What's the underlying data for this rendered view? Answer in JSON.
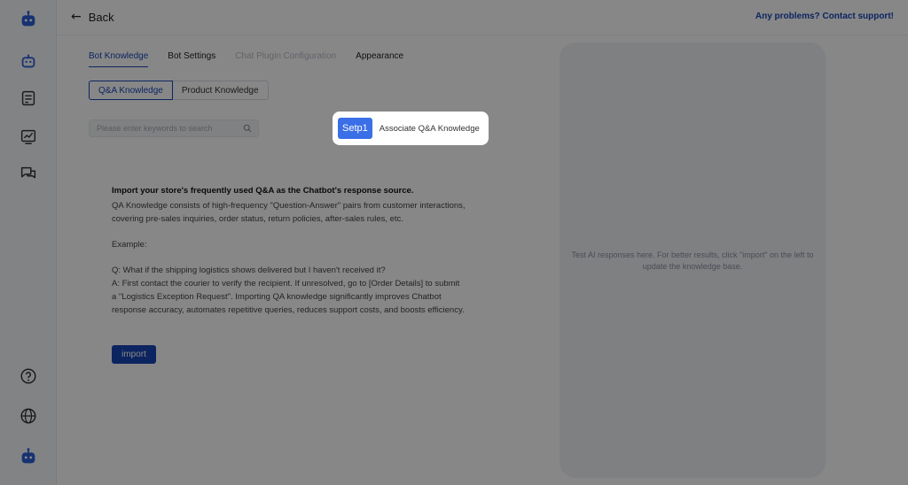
{
  "header": {
    "back_label": "Back",
    "support_link": "Any problems? Contact support!"
  },
  "sidebar": {
    "items": [
      {
        "icon": "bot-logo-icon"
      },
      {
        "icon": "robot-icon"
      },
      {
        "icon": "document-list-icon"
      },
      {
        "icon": "analytics-chart-icon"
      },
      {
        "icon": "chat-bubbles-icon"
      },
      {
        "icon": "help-circle-icon"
      },
      {
        "icon": "globe-icon"
      },
      {
        "icon": "bot-avatar-icon"
      }
    ]
  },
  "tabs": [
    {
      "label": "Bot Knowledge",
      "state": "active"
    },
    {
      "label": "Bot Settings",
      "state": "normal"
    },
    {
      "label": "Chat Plugin Configuration",
      "state": "disabled"
    },
    {
      "label": "Appearance",
      "state": "normal"
    }
  ],
  "knowledge_type": {
    "options": [
      "Q&A Knowledge",
      "Product Knowledge"
    ],
    "selected": "Q&A Knowledge"
  },
  "search": {
    "placeholder": "Please enter keywords to search",
    "value": ""
  },
  "content": {
    "title": "Import your store's frequently used Q&A as the Chatbot's response source.",
    "description": "QA Knowledge consists of high-frequency \"Question-Answer\" pairs from customer interactions, covering pre-sales inquiries, order status, return policies, after-sales rules, etc.",
    "example_label": "Example:",
    "example_q": "Q: What if the shipping logistics shows delivered but I haven't received it?",
    "example_a": "A: First contact the courier to verify the recipient. If unresolved, go to [Order Details] to submit a \"Logistics Exception Request\". Importing QA knowledge significantly improves Chatbot response accuracy, automates repetitive queries, reduces support costs, and boosts efficiency.",
    "import_label": "import"
  },
  "preview": {
    "hint": "Test AI responses here. For better results, click \"import\" on the left to update the knowledge base."
  },
  "tour": {
    "step_badge": "Setp1",
    "step_text": "Associate Q&A Knowledge"
  },
  "colors": {
    "accent": "#1846b8",
    "step_badge": "#3a6fe8",
    "overlay": "rgba(0,0,0,0.47)"
  }
}
